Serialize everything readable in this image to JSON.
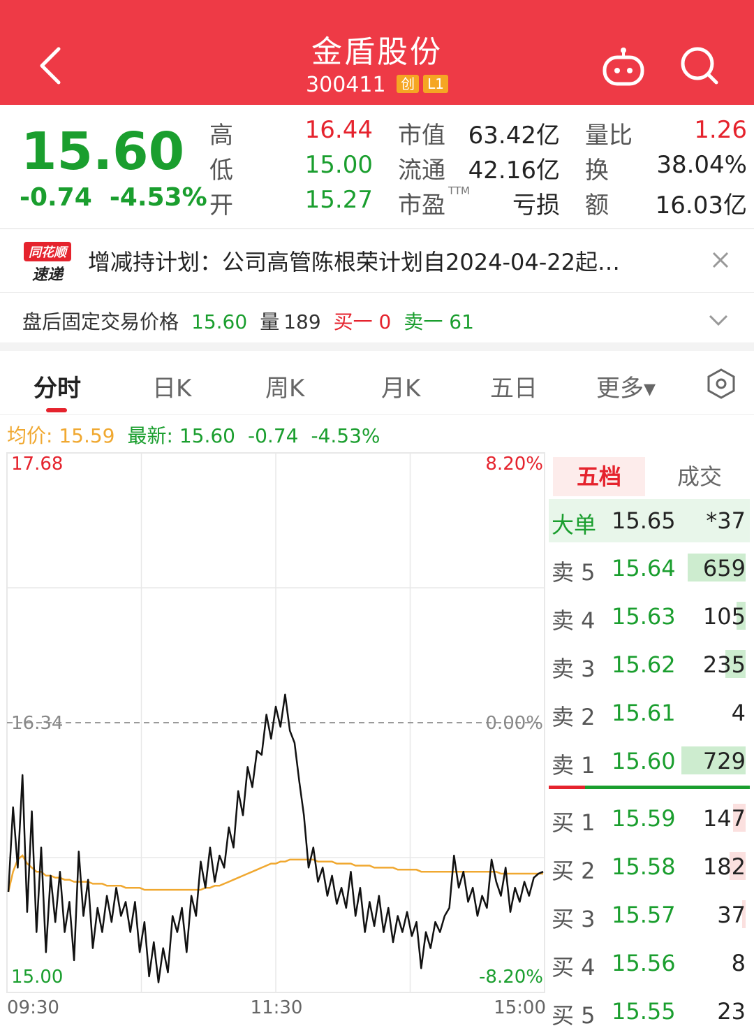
{
  "header": {
    "title": "金盾股份",
    "code": "300411",
    "badges": [
      "创",
      "L1"
    ]
  },
  "quote": {
    "last_price": "15.60",
    "change": "-0.74",
    "change_pct": "-4.53%",
    "rows": [
      [
        {
          "label": "高",
          "value": "16.44",
          "color": "red"
        },
        {
          "label": "市值",
          "value": "63.42亿"
        },
        {
          "label": "量比",
          "value": "1.26",
          "color": "red"
        }
      ],
      [
        {
          "label": "低",
          "value": "15.00",
          "color": "green"
        },
        {
          "label": "流通",
          "value": "42.16亿"
        },
        {
          "label": "换",
          "value": "38.04%"
        }
      ],
      [
        {
          "label": "开",
          "value": "15.27",
          "color": "green"
        },
        {
          "label": "市盈",
          "value": "亏损",
          "sup": "TTM"
        },
        {
          "label": "额",
          "value": "16.03亿"
        }
      ]
    ]
  },
  "news": {
    "logo_top": "同花顺",
    "logo_bottom": "速递",
    "text": "增减持计划：公司高管陈根荣计划自2024-04-22起…"
  },
  "after_hours": {
    "label": "盘后固定交易价格",
    "price": "15.60",
    "volume_label": "量",
    "volume": "189",
    "buy1": "买一 0",
    "sell1": "卖一 61"
  },
  "tabs": [
    "分时",
    "日K",
    "周K",
    "月K",
    "五日",
    "更多▾"
  ],
  "info": {
    "avg": "均价: 15.59",
    "latest": "最新: 15.60",
    "change": "-0.74",
    "change_pct": "-4.53%"
  },
  "chart_data": {
    "type": "line",
    "title": "",
    "y_left_labels": [
      "17.68",
      "16.34",
      "15.00"
    ],
    "y_right_labels": [
      "8.20%",
      "0.00%",
      "-8.20%"
    ],
    "x_labels": [
      "09:30",
      "11:30",
      "15:00"
    ],
    "ylim": [
      15.0,
      17.68
    ],
    "prev_close": 16.34,
    "colors": {
      "price": "#111111",
      "avg": "#f0a830",
      "grid": "#e8e8e8",
      "prevclose": "#9a9a9a"
    },
    "price": [
      15.5,
      15.92,
      15.62,
      16.08,
      15.4,
      15.9,
      15.3,
      15.72,
      15.2,
      15.58,
      15.35,
      15.6,
      15.3,
      15.45,
      15.16,
      15.7,
      15.38,
      15.56,
      15.22,
      15.42,
      15.3,
      15.48,
      15.35,
      15.52,
      15.38,
      15.45,
      15.3,
      15.45,
      15.2,
      15.35,
      15.08,
      15.25,
      15.05,
      15.22,
      15.1,
      15.38,
      15.3,
      15.42,
      15.2,
      15.48,
      15.38,
      15.65,
      15.52,
      15.72,
      15.55,
      15.68,
      15.62,
      15.82,
      15.72,
      16.0,
      15.88,
      16.12,
      16.02,
      16.2,
      16.18,
      16.38,
      16.26,
      16.42,
      16.32,
      16.48,
      16.3,
      16.24,
      16.05,
      15.88,
      15.62,
      15.72,
      15.55,
      15.62,
      15.48,
      15.58,
      15.44,
      15.52,
      15.42,
      15.6,
      15.38,
      15.52,
      15.3,
      15.45,
      15.33,
      15.48,
      15.3,
      15.42,
      15.25,
      15.38,
      15.3,
      15.4,
      15.28,
      15.35,
      15.12,
      15.3,
      15.22,
      15.35,
      15.3,
      15.38,
      15.42,
      15.68,
      15.52,
      15.6,
      15.45,
      15.52,
      15.38,
      15.48,
      15.42,
      15.66,
      15.55,
      15.48,
      15.62,
      15.4,
      15.52,
      15.45,
      15.55,
      15.48,
      15.57,
      15.59,
      15.6
    ],
    "avg": [
      15.5,
      15.6,
      15.66,
      15.68,
      15.64,
      15.62,
      15.6,
      15.6,
      15.58,
      15.58,
      15.57,
      15.57,
      15.56,
      15.56,
      15.55,
      15.55,
      15.55,
      15.55,
      15.54,
      15.54,
      15.54,
      15.53,
      15.53,
      15.53,
      15.53,
      15.52,
      15.52,
      15.52,
      15.52,
      15.51,
      15.51,
      15.51,
      15.51,
      15.51,
      15.51,
      15.51,
      15.51,
      15.51,
      15.51,
      15.51,
      15.51,
      15.51,
      15.52,
      15.52,
      15.53,
      15.53,
      15.54,
      15.55,
      15.56,
      15.57,
      15.58,
      15.59,
      15.6,
      15.61,
      15.62,
      15.63,
      15.64,
      15.64,
      15.65,
      15.65,
      15.66,
      15.66,
      15.66,
      15.66,
      15.66,
      15.66,
      15.65,
      15.65,
      15.65,
      15.65,
      15.64,
      15.64,
      15.64,
      15.64,
      15.63,
      15.63,
      15.63,
      15.63,
      15.62,
      15.62,
      15.62,
      15.62,
      15.62,
      15.61,
      15.61,
      15.61,
      15.61,
      15.61,
      15.6,
      15.6,
      15.6,
      15.6,
      15.6,
      15.6,
      15.6,
      15.6,
      15.6,
      15.6,
      15.6,
      15.6,
      15.6,
      15.6,
      15.6,
      15.6,
      15.6,
      15.59,
      15.59,
      15.59,
      15.59,
      15.59,
      15.59,
      15.59,
      15.59,
      15.59,
      15.59
    ]
  },
  "orderbook": {
    "tabs": [
      "五档",
      "成交"
    ],
    "big_order": {
      "label": "大单",
      "price": "15.65",
      "volume": "*37"
    },
    "asks": [
      {
        "label": "卖 5",
        "price": "15.64",
        "volume": "659",
        "bar": 0.9
      },
      {
        "label": "卖 4",
        "price": "15.63",
        "volume": "105",
        "bar": 0.14
      },
      {
        "label": "卖 3",
        "price": "15.62",
        "volume": "235",
        "bar": 0.32
      },
      {
        "label": "卖 2",
        "price": "15.61",
        "volume": "4",
        "bar": 0.0
      },
      {
        "label": "卖 1",
        "price": "15.60",
        "volume": "729",
        "bar": 1.0
      }
    ],
    "bids": [
      {
        "label": "买 1",
        "price": "15.59",
        "volume": "147",
        "bar": 0.2
      },
      {
        "label": "买 2",
        "price": "15.58",
        "volume": "182",
        "bar": 0.25
      },
      {
        "label": "买 3",
        "price": "15.57",
        "volume": "37",
        "bar": 0.05
      },
      {
        "label": "买 4",
        "price": "15.56",
        "volume": "8",
        "bar": 0.0
      },
      {
        "label": "买 5",
        "price": "15.55",
        "volume": "23",
        "bar": 0.0
      }
    ]
  }
}
